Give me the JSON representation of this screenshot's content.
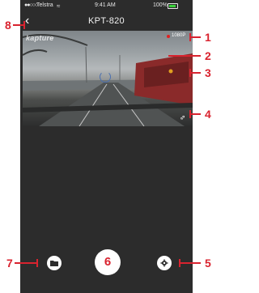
{
  "status_bar": {
    "signal": "●●○○○",
    "carrier": "Telstra",
    "time": "9:41 AM",
    "battery": "100%"
  },
  "header": {
    "back_icon": "chevron-left-icon",
    "title": "KPT-820"
  },
  "video": {
    "brand": "kapture",
    "resolution": "1080P"
  },
  "bottom_bar": {
    "capture_number": "6"
  },
  "callouts": {
    "c1": "1",
    "c2": "2",
    "c3": "3",
    "c4": "4",
    "c5": "5",
    "c6": "6",
    "c7": "7",
    "c8": "8"
  },
  "colors": {
    "accent": "#d9232f",
    "background": "#2c2c2c",
    "battery": "#3ad13a",
    "record": "#e02020"
  }
}
